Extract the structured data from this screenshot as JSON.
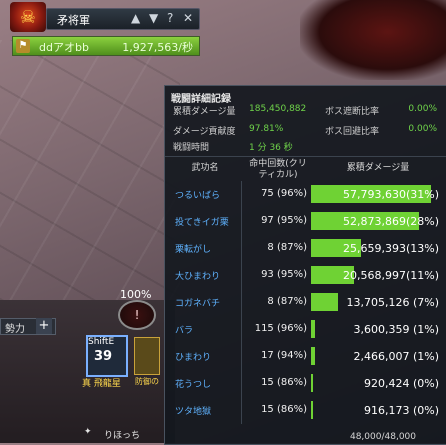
{
  "boss": {
    "name": "矛将軍",
    "icons": {
      "up": "▲",
      "down": "▼",
      "help": "?",
      "close": "✕"
    },
    "player_name": "ddアオbb",
    "player_dps": "1,927,563/秒"
  },
  "panel": {
    "title": "戦闘詳細記録",
    "summary": {
      "total_damage_label": "累積ダメージ量",
      "total_damage_value": "185,450,882",
      "contribution_label": "ダメージ貢献度",
      "contribution_value": "97.81%",
      "battle_time_label": "戦闘時間",
      "battle_time_value": "1 分 36 秒",
      "boss_block_label": "ボス遮断比率",
      "boss_block_value": "0.00%",
      "boss_evade_label": "ボス回避比率",
      "boss_evade_value": "0.00%"
    },
    "columns": {
      "skill": "武功名",
      "hits": "命中回数(クリティカル)",
      "damage": "累積ダメージ量"
    },
    "rows": [
      {
        "skill": "つるいばら",
        "hits": "75 (96%)",
        "damage": "57,793,630(31%)",
        "pct": 31
      },
      {
        "skill": "投てきイガ栗",
        "hits": "97 (95%)",
        "damage": "52,873,869(28%)",
        "pct": 28
      },
      {
        "skill": "栗転がし",
        "hits": "8 (87%)",
        "damage": "25,659,393(13%)",
        "pct": 13
      },
      {
        "skill": "大ひまわり",
        "hits": "93 (95%)",
        "damage": "20,568,997(11%)",
        "pct": 11
      },
      {
        "skill": "コガネバチ",
        "hits": "8 (87%)",
        "damage": "13,705,126  (7%)",
        "pct": 7
      },
      {
        "skill": "バラ",
        "hits": "115 (96%)",
        "damage": "3,600,359  (1%)",
        "pct": 1
      },
      {
        "skill": "ひまわり",
        "hits": "17 (94%)",
        "damage": "2,466,007  (1%)",
        "pct": 1
      },
      {
        "skill": "花うつし",
        "hits": "15 (86%)",
        "damage": "920,424  (0%)",
        "pct": 0
      },
      {
        "skill": "ツタ地獄",
        "hits": "15 (86%)",
        "damage": "916,173  (0%)",
        "pct": 0
      }
    ]
  },
  "hud": {
    "skill_panel_label": "勢力",
    "plus": "+",
    "percent": "100%",
    "skill_ring_glyph": "!",
    "skill_key": "ShiftE",
    "skill_count": "39",
    "skill_name": "真 飛龍星",
    "skill_name2": "防御の",
    "bottom_text": "りほっち",
    "bottom_numbers": "48,000/48,000"
  },
  "colors": {
    "bar": "#6fd234",
    "skill_name": "#5fb3ff",
    "accent_green": "#6fd34a"
  }
}
